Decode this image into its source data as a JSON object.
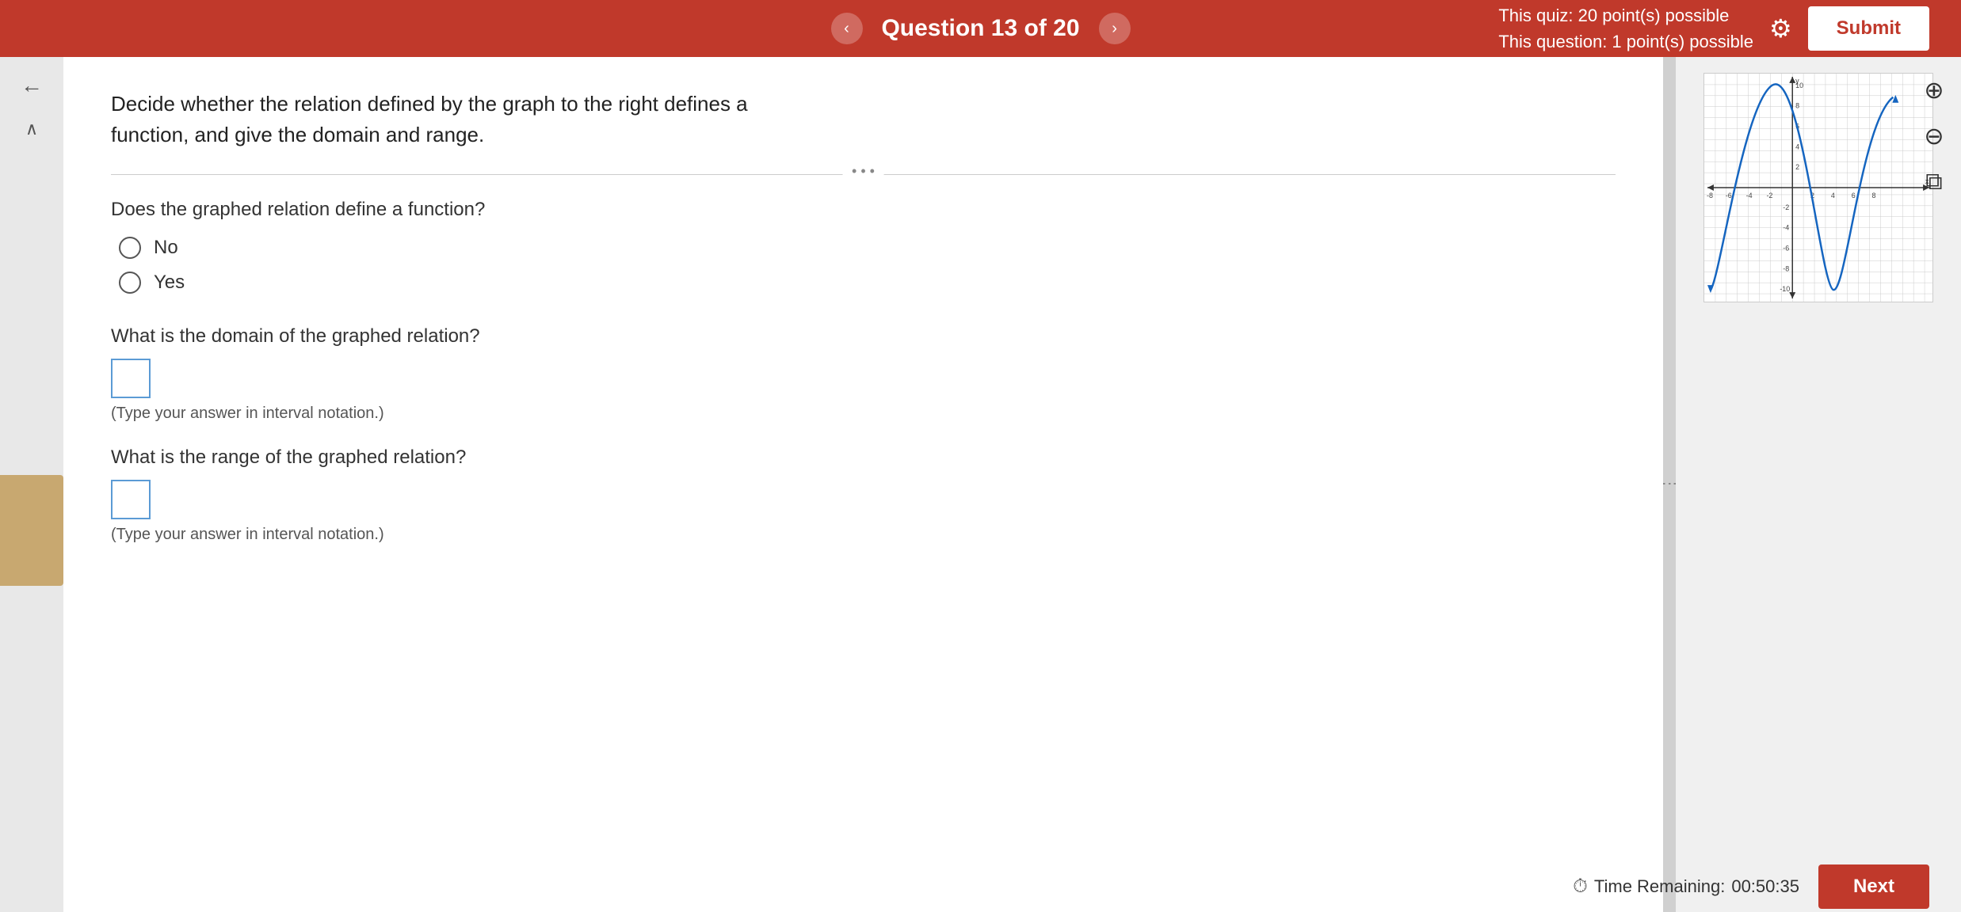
{
  "header": {
    "prev_label": "‹",
    "next_label": "›",
    "question_label": "Question 13 of 20",
    "quiz_points": "This quiz: 20 point(s) possible",
    "question_points": "This question: 1 point(s) possible",
    "submit_label": "Submit"
  },
  "sidebar": {
    "back_arrow": "←",
    "collapse_arrow": "∧"
  },
  "question": {
    "text": "Decide whether the relation defined by the graph to the right defines a function, and give the domain and range.",
    "sub1": "Does the graphed relation define a function?",
    "option_no": "No",
    "option_yes": "Yes",
    "domain_label": "What is the domain of the graphed relation?",
    "domain_hint": "(Type your answer in interval notation.)",
    "range_label": "What is the range of the graphed relation?",
    "range_hint": "(Type your answer in interval notation.)"
  },
  "graph": {
    "zoom_in_icon": "⊕",
    "zoom_out_icon": "⊖",
    "external_icon": "⧉",
    "x_label": "x",
    "y_label": "y"
  },
  "footer": {
    "time_label": "Time Remaining:",
    "time_value": "00:50:35",
    "next_label": "Next"
  },
  "divider_dots": "• • •"
}
